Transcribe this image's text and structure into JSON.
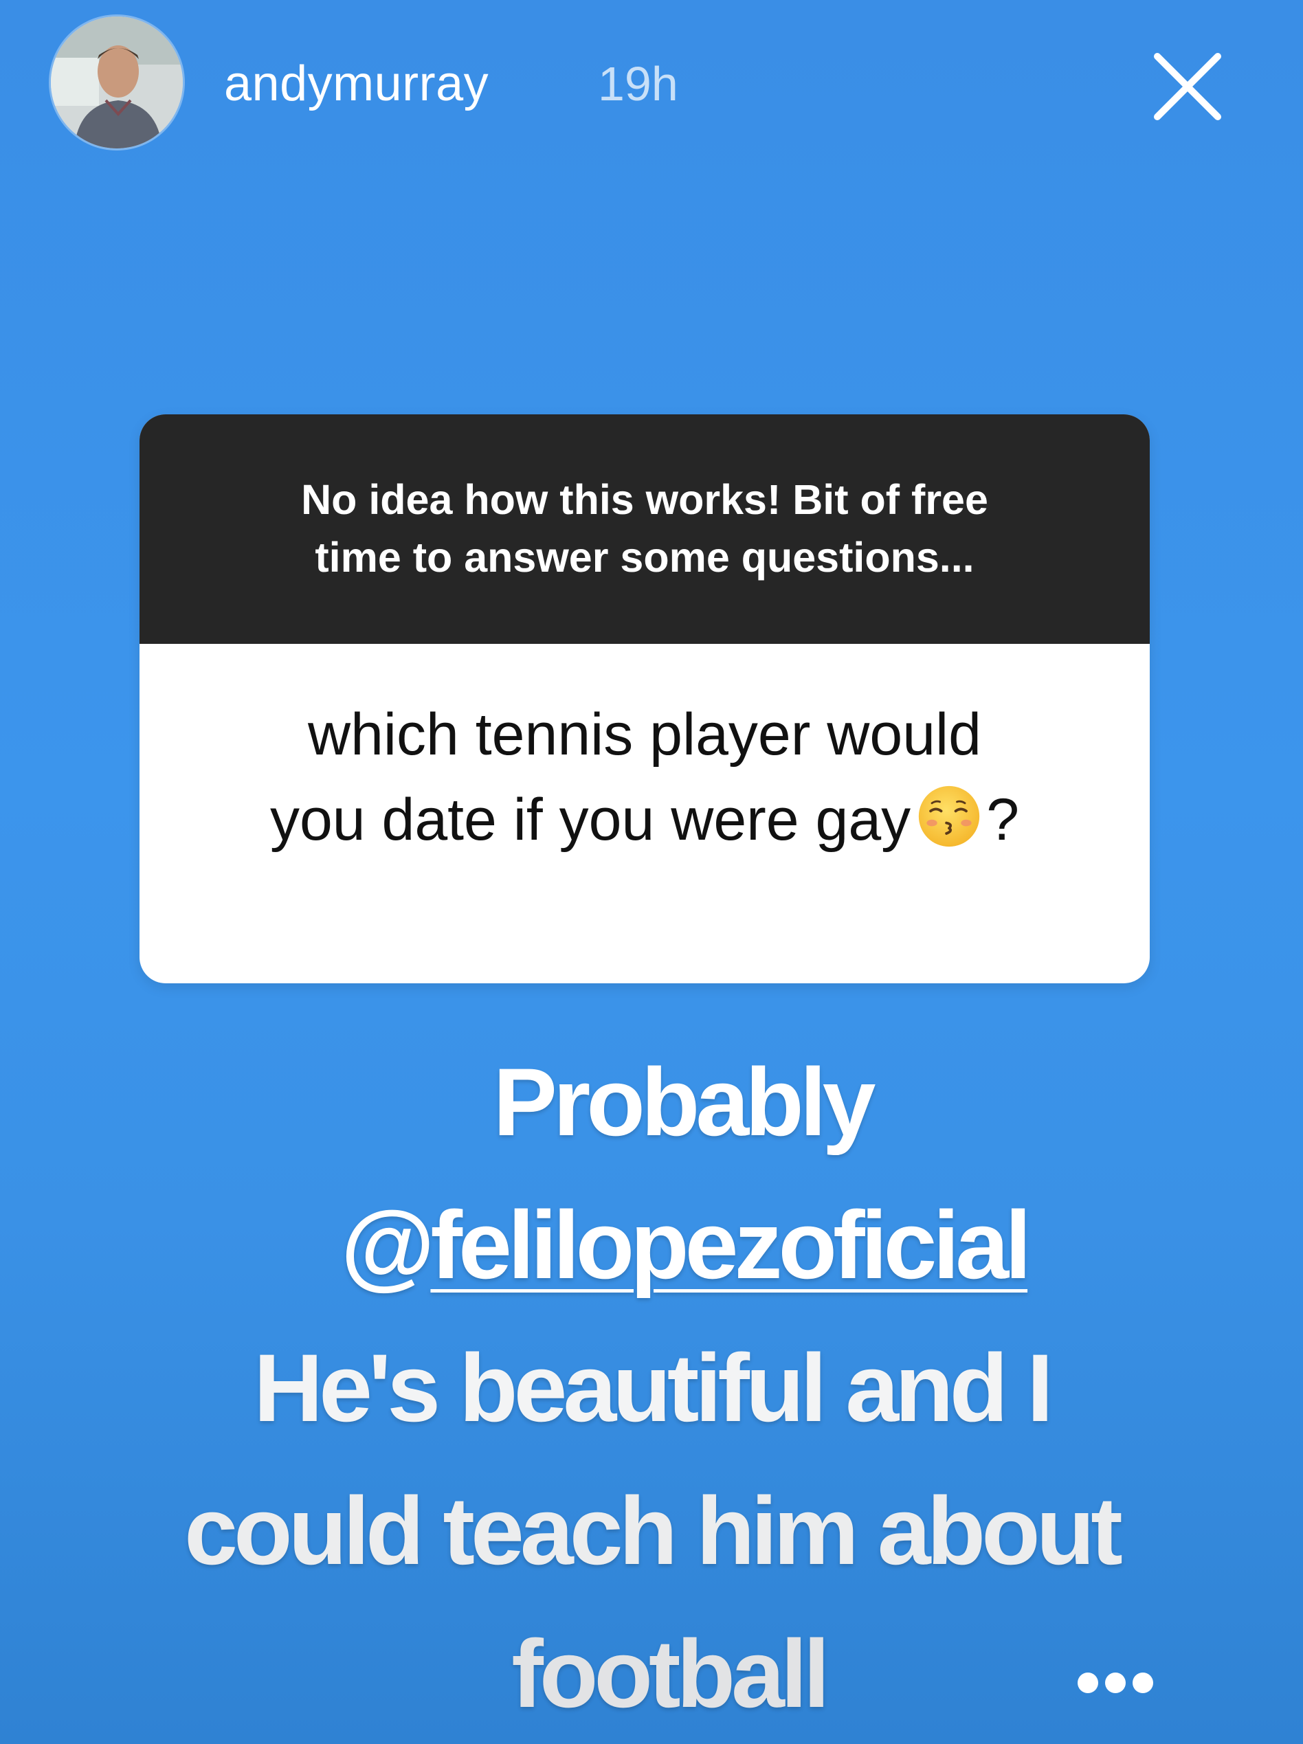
{
  "header": {
    "username": "andymurray",
    "timestamp": "19h"
  },
  "icons": {
    "avatar": "profile-photo",
    "close": "close-icon",
    "more": "more-options-icon",
    "emoji": "kissing-face-with-closed-eyes"
  },
  "question_sticker": {
    "prompt_line1": "No idea how this works! Bit of free",
    "prompt_line2": "time to answer some questions...",
    "question_line1": "which tennis player would",
    "question_line2_before_emoji": "you date if you were gay",
    "question_line2_after_emoji": "?"
  },
  "answer": {
    "line1": "Probably",
    "mention_at": "@",
    "mention_name": "felilopezoficial",
    "line3": "He's beautiful and I",
    "line4": "could teach him about",
    "line5": "football"
  },
  "colors": {
    "background": "#3c95ec",
    "prompt_bg": "#262626",
    "card_bg": "#ffffff",
    "text_light": "#ffffff"
  }
}
